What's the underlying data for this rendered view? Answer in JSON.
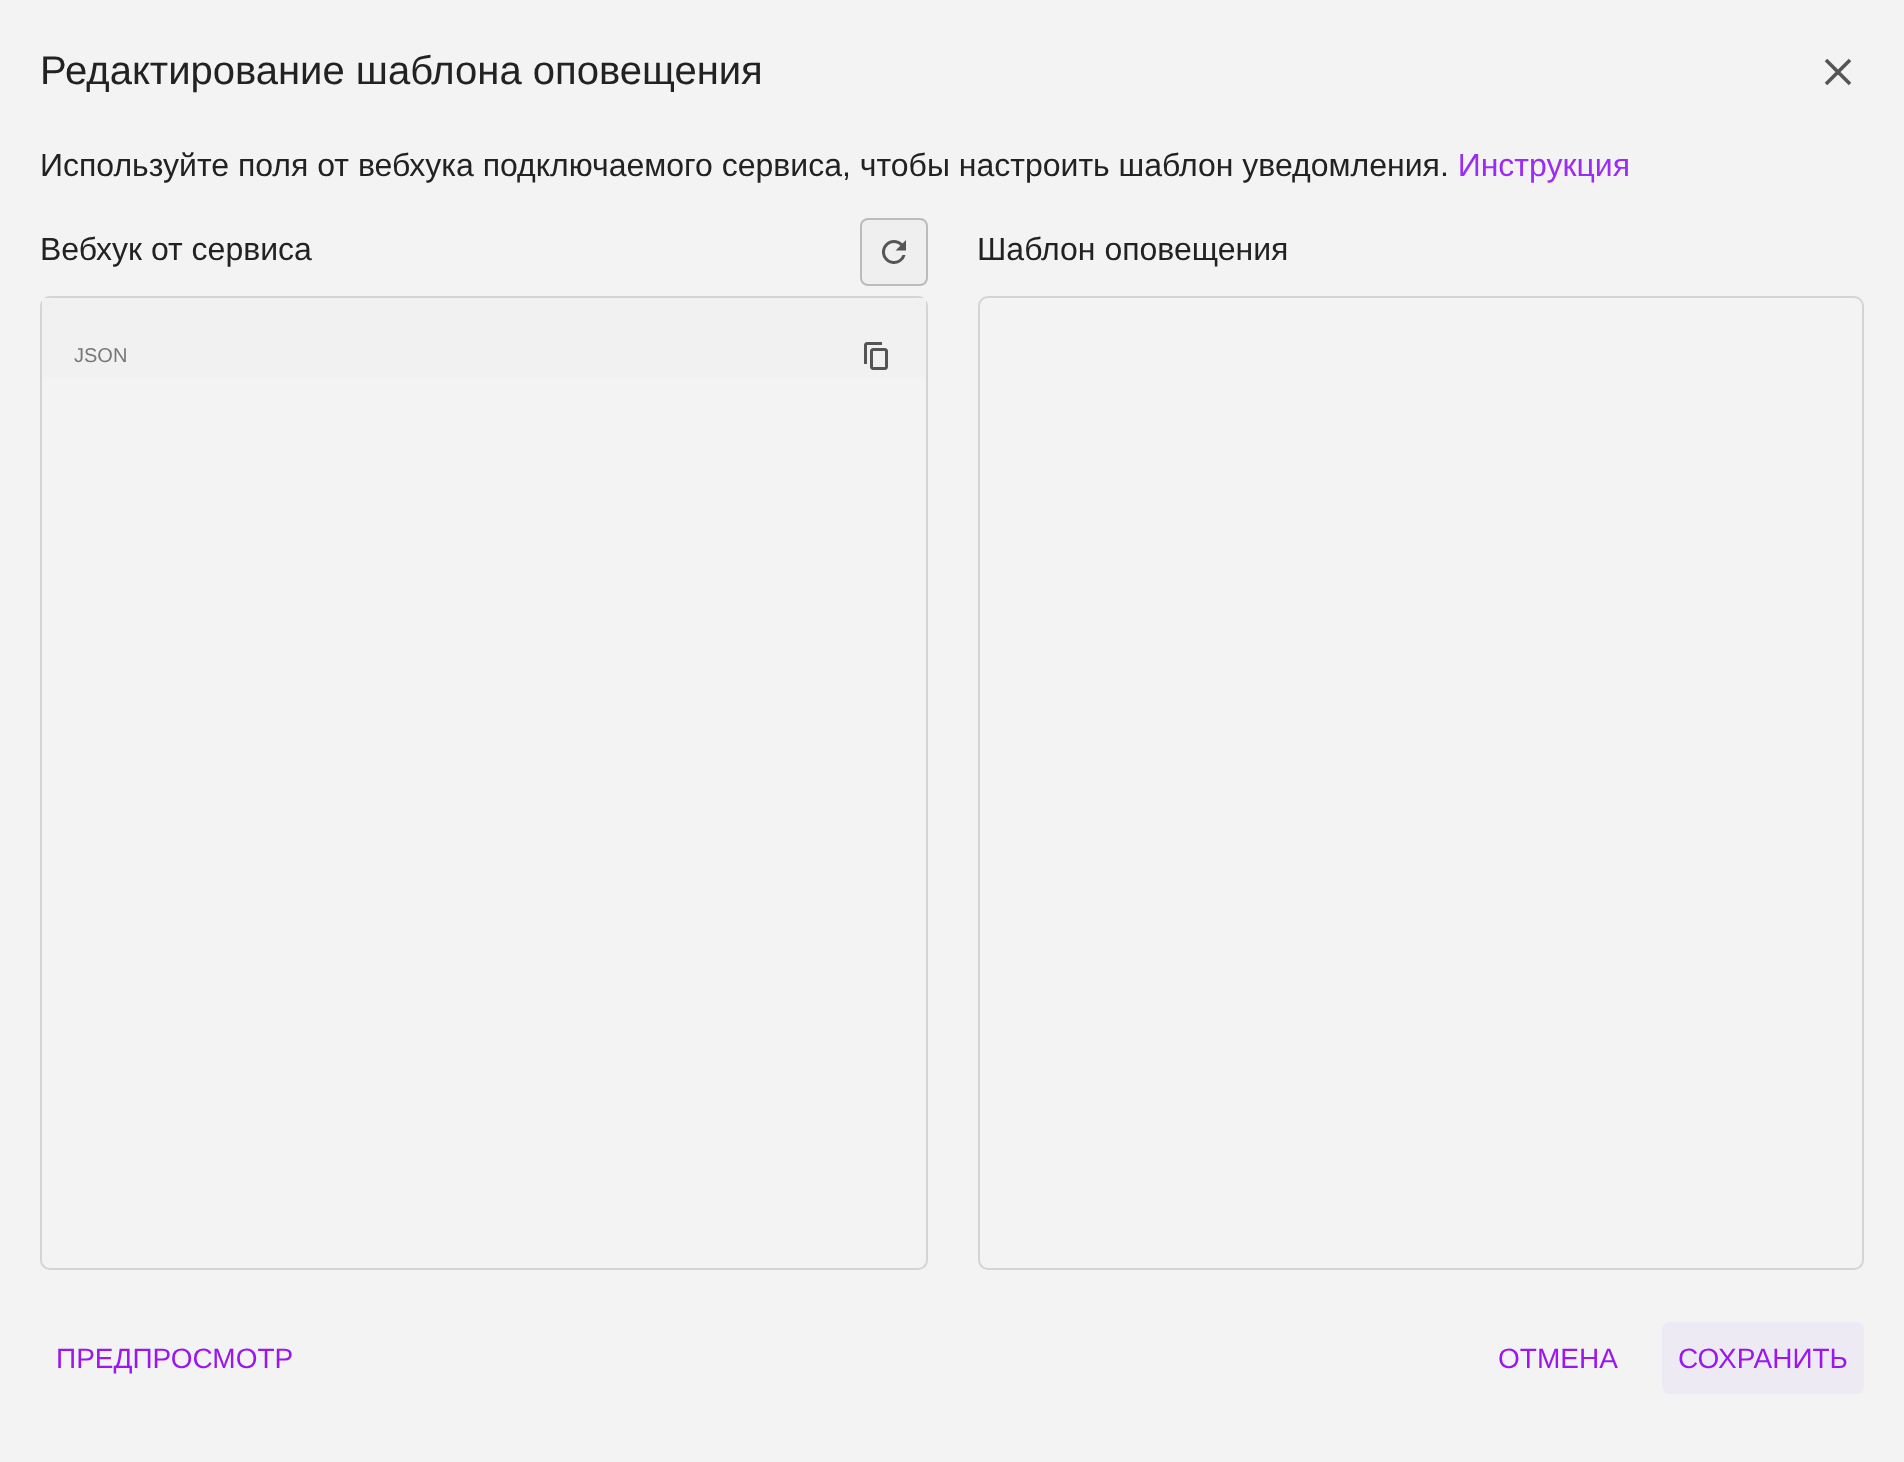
{
  "dialog": {
    "title": "Редактирование шаблона оповещения",
    "description": "Используйте поля от вебхука подключаемого сервиса, чтобы настроить шаблон уведомления.",
    "link": "Инструкция"
  },
  "webhook": {
    "heading": "Вебхук от сервиса",
    "editor_label": "JSON"
  },
  "template": {
    "heading": "Шаблон оповещения"
  },
  "buttons": [
    {
      "label": "ПРЕДПРОСМОТР",
      "kind": "text"
    },
    {
      "label": "ОТМЕНА",
      "kind": "text"
    },
    {
      "label": "СОХРАНИТЬ",
      "kind": "tonal"
    }
  ]
}
